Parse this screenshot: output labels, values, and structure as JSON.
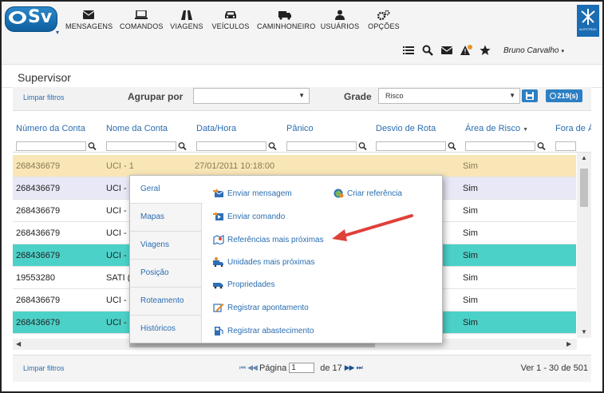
{
  "app": {
    "logo_text": "Sv",
    "logo_caret": "▾",
    "brand_text": "AUTOTRAC",
    "user_name": "Bruno Carvalho",
    "user_caret": "▾",
    "page_title": "Supervisor"
  },
  "nav": [
    {
      "label": "MENSAGENS",
      "icon": "envelope-icon"
    },
    {
      "label": "COMANDOS",
      "icon": "laptop-icon"
    },
    {
      "label": "VIAGENS",
      "icon": "road-icon"
    },
    {
      "label": "VEÍCULOS",
      "icon": "car-icon"
    },
    {
      "label": "CAMINHONEIRO",
      "icon": "truck-icon"
    },
    {
      "label": "USUÁRIOS",
      "icon": "user-icon"
    },
    {
      "label": "OPÇÕES",
      "icon": "gears-icon"
    }
  ],
  "toolbar_icons": [
    "list-icon",
    "search-icon",
    "envelope-icon",
    "alert-icon",
    "star-icon"
  ],
  "filters": {
    "clear_label": "Limpar filtros",
    "group_by_label": "Agrupar por",
    "group_by_value": "",
    "grade_label": "Grade",
    "grade_value": "Risco",
    "count_badge": "219(s)",
    "select_caret": "▼"
  },
  "grid": {
    "columns": [
      "Número da Conta",
      "Nome da Conta",
      "Data/Hora",
      "Pânico",
      "Desvio de Rota",
      "Área de Risco",
      "Fora de Á"
    ],
    "sort_indicator": "▼",
    "rows": [
      {
        "account": "268436679",
        "name": "UCI - 1",
        "datetime": "27/01/2011 10:18:00",
        "risk": "Sim",
        "state": "selected"
      },
      {
        "account": "268436679",
        "name": "UCI -",
        "datetime": "",
        "risk": "Sim",
        "state": "hover"
      },
      {
        "account": "268436679",
        "name": "UCI -",
        "datetime": "",
        "risk": "Sim",
        "state": "normal"
      },
      {
        "account": "268436679",
        "name": "UCI -",
        "datetime": "",
        "risk": "Sim",
        "state": "normal"
      },
      {
        "account": "268436679",
        "name": "UCI -",
        "datetime": "",
        "risk": "Sim",
        "state": "teal"
      },
      {
        "account": "19553280",
        "name": "SATI (",
        "datetime": "",
        "risk": "Sim",
        "state": "normal"
      },
      {
        "account": "268436679",
        "name": "UCI -",
        "datetime": "",
        "risk": "Sim",
        "state": "normal"
      },
      {
        "account": "268436679",
        "name": "UCI -",
        "datetime": "",
        "risk": "Sim",
        "state": "teal"
      }
    ]
  },
  "footer": {
    "clear_label": "Limpar filtros",
    "first": "⏮",
    "prev": "◀◀",
    "page_label": "Página",
    "page_value": "1",
    "of_label": "de 17",
    "next": "▶▶",
    "last": "⏭",
    "records": "Ver 1 - 30 de 501"
  },
  "context_menu": {
    "tabs": [
      "Geral",
      "Mapas",
      "Viagens",
      "Posição",
      "Roteamento",
      "Históricos"
    ],
    "active_tab": "Geral",
    "items": [
      {
        "label": "Enviar mensagem",
        "icon": "send-message-icon"
      },
      {
        "label": "Criar referência",
        "icon": "create-reference-icon"
      },
      {
        "label": "Enviar comando",
        "icon": "send-command-icon"
      },
      {
        "label": "Referências mais próximas",
        "icon": "nearest-references-icon"
      },
      {
        "label": "Unidades mais próximas",
        "icon": "nearest-units-icon"
      },
      {
        "label": "Propriedades",
        "icon": "properties-icon"
      },
      {
        "label": "Registrar apontamento",
        "icon": "register-note-icon"
      },
      {
        "label": "Registrar abastecimento",
        "icon": "register-fuel-icon"
      }
    ]
  },
  "colors": {
    "accent": "#2a6db0",
    "selected_row": "#f8e6b6",
    "teal_row": "#4cd1c8",
    "annotation_arrow": "#e0403a"
  }
}
